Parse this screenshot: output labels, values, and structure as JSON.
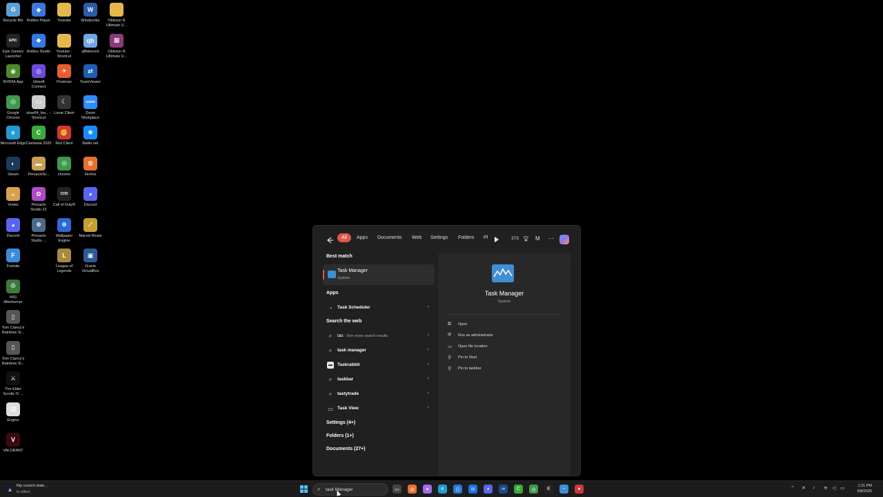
{
  "desktop": {
    "icons": [
      {
        "label": "Recycle Bin",
        "icon": "recycle-bin-icon",
        "color": "#5aa0d8",
        "glyph": "♻"
      },
      {
        "label": "Roblox Player",
        "icon": "roblox-icon",
        "color": "#3a78e0",
        "glyph": "◆"
      },
      {
        "label": "Youtube",
        "icon": "folder-icon",
        "color": "#e6b84a",
        "glyph": ""
      },
      {
        "label": "Windscribe",
        "icon": "windscribe-icon",
        "color": "#2a5aa8",
        "glyph": "W"
      },
      {
        "label": "Oblivion R Ultimate U...",
        "icon": "folder-icon",
        "color": "#e6b84a",
        "glyph": ""
      },
      {
        "label": "Epic Games Launcher",
        "icon": "epic-games-icon",
        "color": "#222222",
        "glyph": "EPIC"
      },
      {
        "label": "Roblox Studio",
        "icon": "roblox-studio-icon",
        "color": "#2f7ae5",
        "glyph": "◆"
      },
      {
        "label": "Youtube - Shortcut",
        "icon": "folder-shortcut-icon",
        "color": "#e6b84a",
        "glyph": ""
      },
      {
        "label": "qBittorrent",
        "icon": "qbittorrent-icon",
        "color": "#6fa8e8",
        "glyph": "qb"
      },
      {
        "label": "Oblivion R Ultimate U...",
        "icon": "winrar-icon",
        "color": "#8a3a7a",
        "glyph": "▦"
      },
      {
        "label": "NVIDIA App",
        "icon": "nvidia-icon",
        "color": "#4a8a2a",
        "glyph": "◉"
      },
      {
        "label": "Postman",
        "icon": "postman-icon",
        "color": "#e85d2b",
        "glyph": "✈"
      },
      {
        "label": "TeamViewer",
        "icon": "teamviewer-icon",
        "color": "#1a5fb4",
        "glyph": "⇄"
      },
      {
        "label": "Google Chrome",
        "icon": "chrome-icon",
        "color": "#3c9a4a",
        "glyph": "◎"
      },
      {
        "label": "Ubisoft Connect",
        "icon": "ubisoft-icon",
        "color": "#6a4ad8",
        "glyph": "◎"
      },
      {
        "label": "Lunar Client",
        "icon": "lunar-client-icon",
        "color": "#333333",
        "glyph": "☾"
      },
      {
        "label": "Zoom Workplace",
        "icon": "zoom-icon",
        "color": "#2d8cff",
        "glyph": "zoom"
      },
      {
        "label": "Microsoft Edge",
        "icon": "edge-icon",
        "color": "#1f9bd6",
        "glyph": "e"
      },
      {
        "label": "skse64_loa... - Shortcut",
        "icon": "skse-icon",
        "color": "#cccccc",
        "glyph": "▭"
      },
      {
        "label": "Battle.net",
        "icon": "battlenet-icon",
        "color": "#148eff",
        "glyph": "✺"
      },
      {
        "label": "Steam",
        "icon": "steam-icon",
        "color": "#1b3a5a",
        "glyph": "◐"
      },
      {
        "label": "Camtasia 2020",
        "icon": "camtasia-icon",
        "color": "#3aaa3a",
        "glyph": "C"
      },
      {
        "label": "Riot Client",
        "icon": "riot-client-icon",
        "color": "#d13639",
        "glyph": "✊"
      },
      {
        "label": "Firefox",
        "icon": "firefox-icon",
        "color": "#e8702a",
        "glyph": "◍"
      },
      {
        "label": "Vortex",
        "icon": "vortex-icon",
        "color": "#d8a04a",
        "glyph": "◒"
      },
      {
        "label": "PinnacleSt...",
        "icon": "pinnacle-icon",
        "color": "#c8a050",
        "glyph": "▬"
      },
      {
        "label": "chrome",
        "icon": "chrome-icon",
        "color": "#3c9a4a",
        "glyph": "◎"
      },
      {
        "label": "Discord",
        "icon": "discord-icon",
        "color": "#5865f2",
        "glyph": "◕"
      },
      {
        "label": "Discord",
        "icon": "discord-icon",
        "color": "#5865f2",
        "glyph": "◕"
      },
      {
        "label": "Pinnacle Studio 22",
        "icon": "pinnacle-studio-icon",
        "color": "#b04ac8",
        "glyph": "✿"
      },
      {
        "label": "Call of Duty®",
        "icon": "call-of-duty-icon",
        "color": "#222222",
        "glyph": "COD"
      },
      {
        "label": "Marvel Rivals",
        "icon": "marvel-rivals-icon",
        "color": "#c8a030",
        "glyph": "⟋"
      },
      {
        "label": "Fortnite",
        "icon": "fortnite-icon",
        "color": "#3a8ae0",
        "glyph": "F"
      },
      {
        "label": "Pinnacle Studio ...",
        "icon": "pinnacle-studio-icon",
        "color": "#4a6a8a",
        "glyph": "⊗"
      },
      {
        "label": "Wallpaper Engine",
        "icon": "wallpaper-engine-icon",
        "color": "#2a6ad8",
        "glyph": "⊛"
      },
      {
        "label": "MSI Afterburner",
        "icon": "msi-afterburner-icon",
        "color": "#3a7a3a",
        "glyph": "✇"
      },
      {
        "label": "League of Legends",
        "icon": "league-icon",
        "color": "#a88a3a",
        "glyph": "L"
      },
      {
        "label": "Oracle VirtualBox",
        "icon": "virtualbox-icon",
        "color": "#2a5a9a",
        "glyph": "▣"
      },
      {
        "label": "Tom Clancy's Rainbow Si...",
        "icon": "rainbow-six-icon",
        "color": "#555555",
        "glyph": "▯"
      },
      {
        "label": "Tom Clancy's Rainbow Si...",
        "icon": "rainbow-six-icon",
        "color": "#555555",
        "glyph": "▯"
      },
      {
        "label": "The Elder Scrolls IV ...",
        "icon": "elder-scrolls-icon",
        "color": "#111111",
        "glyph": "⚔"
      },
      {
        "label": "Engine",
        "icon": "engine-icon",
        "color": "#dddddd",
        "glyph": "▤"
      },
      {
        "label": "VALORANT",
        "icon": "valorant-icon",
        "color": "#3a0a10",
        "glyph": "V"
      }
    ]
  },
  "search_panel": {
    "tabs": [
      "All",
      "Apps",
      "Documents",
      "Web",
      "Settings",
      "Folders",
      "Pl"
    ],
    "count": "373",
    "account_initial": "M",
    "best_match": {
      "heading": "Best match",
      "title": "Task Manager",
      "subtitle": "System"
    },
    "apps_heading": "Apps",
    "apps": [
      {
        "label": "Task Scheduler"
      }
    ],
    "web_heading": "Search the web",
    "web_results": [
      {
        "label": "tas",
        "sub": " - See more search results",
        "icon": "search-icon"
      },
      {
        "label": "task manager",
        "sub": "",
        "icon": "search-icon"
      },
      {
        "label": "Taskrabbit",
        "sub": "",
        "icon": "taskrabbit-icon"
      },
      {
        "label": "taskbar",
        "sub": "",
        "icon": "search-icon"
      },
      {
        "label": "tastytrade",
        "sub": "",
        "icon": "search-icon"
      },
      {
        "label": "Task View",
        "sub": "",
        "icon": "task-view-icon"
      }
    ],
    "sections": [
      "Settings (4+)",
      "Folders (1+)",
      "Documents (27+)"
    ],
    "preview": {
      "title": "Task Manager",
      "subtitle": "System",
      "actions": [
        {
          "label": "Open",
          "icon": "open-icon"
        },
        {
          "label": "Run as administrator",
          "icon": "shield-icon"
        },
        {
          "label": "Open file location",
          "icon": "folder-open-icon"
        },
        {
          "label": "Pin to Start",
          "icon": "pin-icon"
        },
        {
          "label": "Pin to taskbar",
          "icon": "pin-icon"
        }
      ]
    }
  },
  "taskbar": {
    "notification_title": "Rip current state...",
    "notification_sub": "In effect",
    "search_value": "task Manager",
    "time": "1:31 PM",
    "date": "6/8/2025"
  }
}
